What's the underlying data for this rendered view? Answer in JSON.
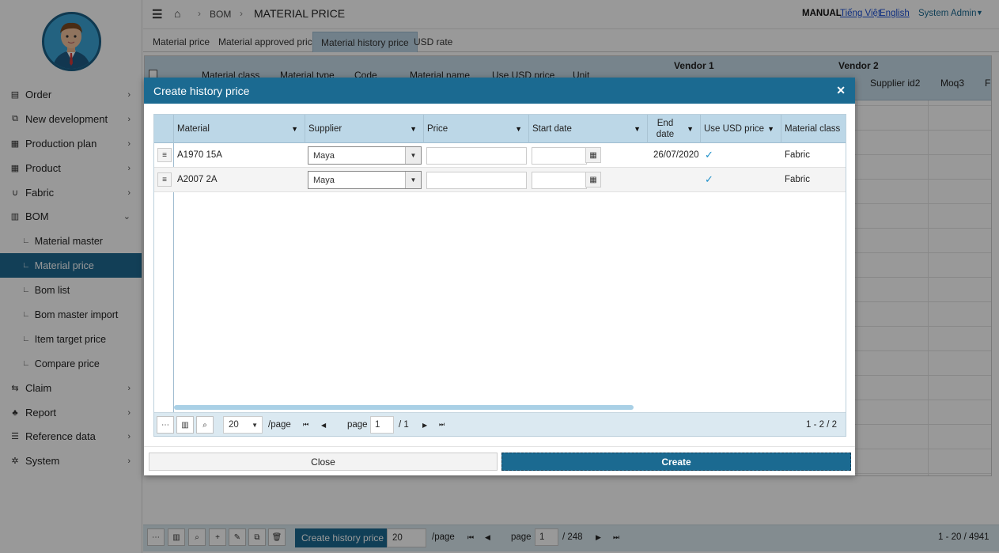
{
  "sidebar": {
    "items": [
      {
        "label": "Order",
        "icon": "document-icon"
      },
      {
        "label": "New development",
        "icon": "link-icon"
      },
      {
        "label": "Production plan",
        "icon": "grid-icon"
      },
      {
        "label": "Product",
        "icon": "grid-icon"
      },
      {
        "label": "Fabric",
        "icon": "magnet-icon"
      },
      {
        "label": "BOM",
        "icon": "table-icon"
      },
      {
        "label": "Claim",
        "icon": "swap-icon"
      },
      {
        "label": "Report",
        "icon": "sitemap-icon"
      },
      {
        "label": "Reference data",
        "icon": "database-icon"
      },
      {
        "label": "System",
        "icon": "gear-icon"
      }
    ],
    "bom_sub": [
      {
        "label": "Material master"
      },
      {
        "label": "Material price"
      },
      {
        "label": "Bom list"
      },
      {
        "label": "Bom master import"
      },
      {
        "label": "Item target price"
      },
      {
        "label": "Compare price"
      }
    ]
  },
  "header": {
    "breadcrumb_bom": "BOM",
    "title": "MATERIAL PRICE",
    "manual": "MANUAL",
    "lang_vi": "Tiếng Việt",
    "lang_en": "English",
    "user": "System Admin"
  },
  "tabs": [
    "Material price",
    "Material approved price",
    "Material history price",
    "USD rate"
  ],
  "background_grid": {
    "columns": [
      "Material class",
      "Material type",
      "Code",
      "Material name",
      "Use USD price",
      "Unit"
    ],
    "vendor1": "Vendor 1",
    "vendor2": "Vendor 2",
    "vendor2_cols": [
      "Supplier id2",
      "Moq3",
      "F"
    ],
    "footer": {
      "create_label": "Create history price",
      "page_size": "20",
      "per_page": "/page",
      "page_label": "page",
      "page": "1",
      "total_pages": "/ 248",
      "range": "1 - 20 / 4941"
    }
  },
  "dialog": {
    "title": "Create history price",
    "columns": [
      "Material",
      "Supplier",
      "Price",
      "Start date",
      "End date",
      "Use USD price",
      "Material class"
    ],
    "rows": [
      {
        "material": "A1970 15A",
        "supplier": "Maya",
        "price": "",
        "start_date": "",
        "end_date": "26/07/2020",
        "use_usd": true,
        "material_class": "Fabric"
      },
      {
        "material": "A2007 2A",
        "supplier": "Maya",
        "price": "",
        "start_date": "",
        "end_date": "",
        "use_usd": true,
        "material_class": "Fabric"
      }
    ],
    "footer": {
      "page_size": "20",
      "per_page": "/page",
      "page_label": "page",
      "page": "1",
      "total_pages": "/ 1",
      "range": "1 - 2 / 2"
    },
    "close_label": "Close",
    "create_label": "Create"
  },
  "colors": {
    "primary": "#1b6a91",
    "header_bg": "#bcd7e7",
    "accent": "#1d8fc9"
  }
}
